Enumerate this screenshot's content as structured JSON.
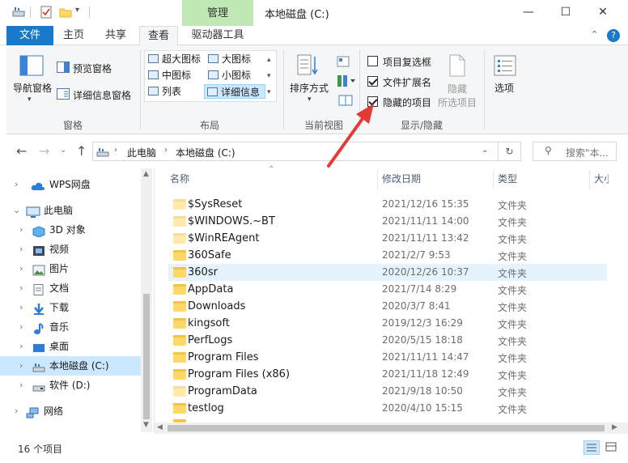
{
  "titlebar": {
    "manage_tab": "管理",
    "window_title": "本地磁盘 (C:)",
    "minimize": "—",
    "maximize": "☐",
    "close": "✕"
  },
  "tabs": {
    "file": "文件",
    "home": "主页",
    "share": "共享",
    "view": "查看",
    "drive_tools": "驱动器工具"
  },
  "ribbon": {
    "pane": {
      "nav_pane": "导航窗格",
      "preview_pane": "预览窗格",
      "details_pane": "详细信息窗格",
      "label": "窗格"
    },
    "layout": {
      "extra_large": "超大图标",
      "large": "大图标",
      "medium": "中图标",
      "small": "小图标",
      "list": "列表",
      "details": "详细信息",
      "label": "布局"
    },
    "current_view": {
      "sort_by": "排序方式",
      "label": "当前视图"
    },
    "show_hide": {
      "item_checkboxes": "项目复选框",
      "file_extensions": "文件扩展名",
      "hidden_items": "隐藏的项目",
      "hide_selected_1": "隐藏",
      "hide_selected_2": "所选项目",
      "label": "显示/隐藏",
      "item_checkboxes_checked": false,
      "file_extensions_checked": true,
      "hidden_items_checked": true
    },
    "options": "选项"
  },
  "address": {
    "crumb1": "此电脑",
    "crumb2": "本地磁盘 (C:)",
    "search_placeholder": "搜索\"本..."
  },
  "nav": {
    "items": [
      {
        "label": "WPS网盘"
      },
      {
        "label": "此电脑"
      },
      {
        "label": "3D 对象"
      },
      {
        "label": "视频"
      },
      {
        "label": "图片"
      },
      {
        "label": "文档"
      },
      {
        "label": "下载"
      },
      {
        "label": "音乐"
      },
      {
        "label": "桌面"
      },
      {
        "label": "本地磁盘 (C:)"
      },
      {
        "label": "软件 (D:)"
      },
      {
        "label": "网络"
      }
    ]
  },
  "columns": {
    "name": "名称",
    "date": "修改日期",
    "type": "类型",
    "size": "大小"
  },
  "files": [
    {
      "name": "$SysReset",
      "date": "2021/12/16 15:35",
      "type": "文件夹"
    },
    {
      "name": "$WINDOWS.~BT",
      "date": "2021/11/11 14:00",
      "type": "文件夹"
    },
    {
      "name": "$WinREAgent",
      "date": "2021/11/11 13:42",
      "type": "文件夹"
    },
    {
      "name": "360Safe",
      "date": "2021/2/7 9:53",
      "type": "文件夹"
    },
    {
      "name": "360sr",
      "date": "2020/12/26 10:37",
      "type": "文件夹"
    },
    {
      "name": "AppData",
      "date": "2021/7/14 8:29",
      "type": "文件夹"
    },
    {
      "name": "Downloads",
      "date": "2020/3/7 8:41",
      "type": "文件夹"
    },
    {
      "name": "kingsoft",
      "date": "2019/12/3 16:29",
      "type": "文件夹"
    },
    {
      "name": "PerfLogs",
      "date": "2020/5/15 18:18",
      "type": "文件夹"
    },
    {
      "name": "Program Files",
      "date": "2021/11/11 14:47",
      "type": "文件夹"
    },
    {
      "name": "Program Files (x86)",
      "date": "2021/11/18 12:49",
      "type": "文件夹"
    },
    {
      "name": "ProgramData",
      "date": "2021/9/18 10:50",
      "type": "文件夹"
    },
    {
      "name": "testlog",
      "date": "2020/4/10 15:15",
      "type": "文件夹"
    }
  ],
  "status": {
    "count": "16 个项目"
  }
}
